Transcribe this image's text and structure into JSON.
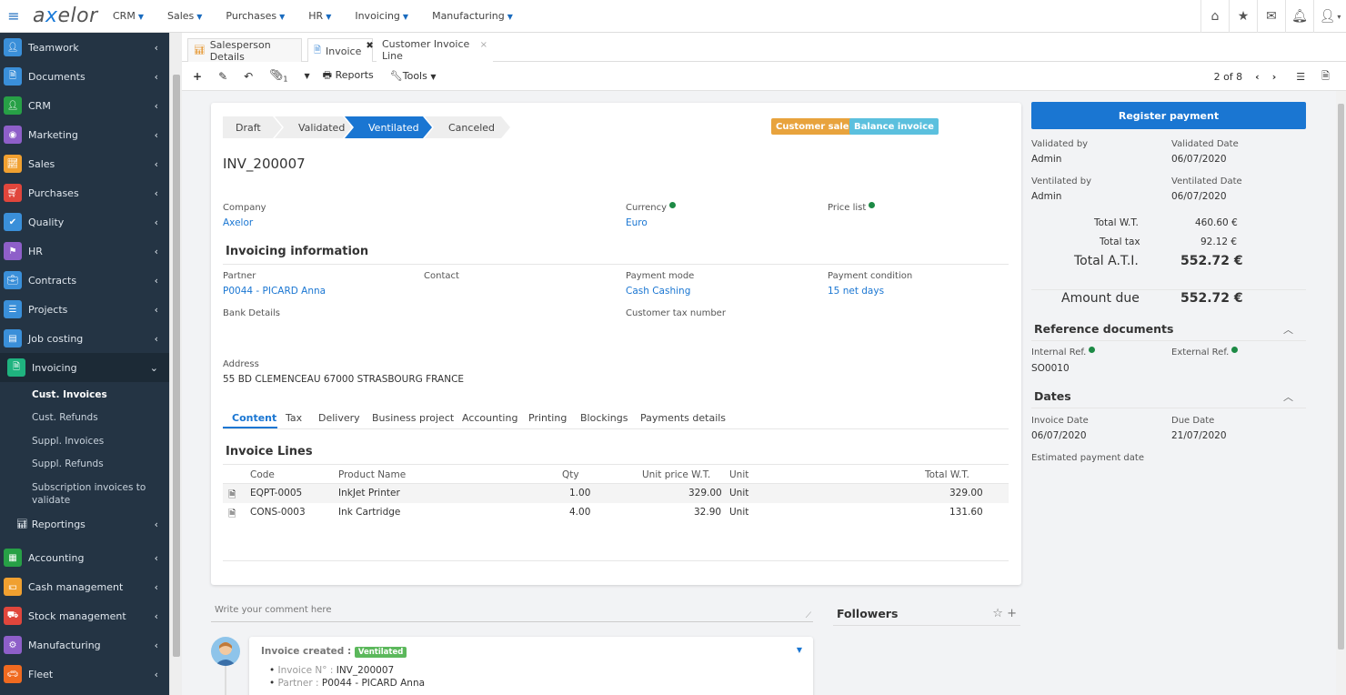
{
  "app": {
    "logo": "axelor"
  },
  "topmenu": [
    {
      "label": "CRM"
    },
    {
      "label": "Sales"
    },
    {
      "label": "Purchases"
    },
    {
      "label": "HR"
    },
    {
      "label": "Invoicing"
    },
    {
      "label": "Manufacturing"
    }
  ],
  "topicons": [
    "home-icon",
    "star-icon",
    "envelope-icon",
    "bell-icon",
    "user-icon"
  ],
  "sidebar": {
    "items": [
      {
        "label": "Teamwork",
        "color": "#3a8fd9"
      },
      {
        "label": "Documents",
        "color": "#3a8fd9"
      },
      {
        "label": "CRM",
        "color": "#27a046"
      },
      {
        "label": "Marketing",
        "color": "#8e5fc9"
      },
      {
        "label": "Sales",
        "color": "#f0a030"
      },
      {
        "label": "Purchases",
        "color": "#e0463c"
      },
      {
        "label": "Quality",
        "color": "#3a8fd9"
      },
      {
        "label": "HR",
        "color": "#8e5fc9"
      },
      {
        "label": "Contracts",
        "color": "#3a8fd9"
      },
      {
        "label": "Projects",
        "color": "#3a8fd9"
      },
      {
        "label": "Job costing",
        "color": "#3a8fd9"
      },
      {
        "label": "Invoicing",
        "color": "#1fb37f"
      }
    ],
    "subitems": [
      "Cust. Invoices",
      "Cust. Refunds",
      "Suppl. Invoices",
      "Suppl. Refunds",
      "Subscription invoices to",
      "validate"
    ],
    "reportings": "Reportings",
    "items2": [
      {
        "label": "Accounting",
        "color": "#27a046"
      },
      {
        "label": "Cash management",
        "color": "#f0a030"
      },
      {
        "label": "Stock management",
        "color": "#e0463c"
      },
      {
        "label": "Manufacturing",
        "color": "#8e5fc9"
      },
      {
        "label": "Fleet",
        "color": "#f06a20"
      }
    ]
  },
  "tabs": [
    {
      "label": "Salesperson Details"
    },
    {
      "label": "Invoice"
    },
    {
      "label": "Customer Invoice Line"
    }
  ],
  "toolbar": {
    "attach_count": "1",
    "reports": "Reports",
    "tools": "Tools",
    "pager": "2 of 8"
  },
  "statusbar": [
    "Draft",
    "Validated",
    "Ventilated",
    "Canceled"
  ],
  "badges": {
    "customer_sale": "Customer sale",
    "balance_invoice": "Balance invoice",
    "customer_sale_color": "#e8a33d",
    "balance_color": "#5bc0de"
  },
  "invoice": {
    "number": "INV_200007",
    "company_label": "Company",
    "company": "Axelor",
    "currency_label": "Currency",
    "currency": "Euro",
    "pricelist_label": "Price list",
    "section_invoicing": "Invoicing information",
    "partner_label": "Partner",
    "partner": "P0044 - PICARD Anna",
    "contact_label": "Contact",
    "paymode_label": "Payment mode",
    "paymode": "Cash Cashing",
    "paycond_label": "Payment condition",
    "paycond": "15 net days",
    "bank_label": "Bank Details",
    "taxnum_label": "Customer tax number",
    "address_label": "Address",
    "address": "55 BD CLEMENCEAU 67000 STRASBOURG FRANCE"
  },
  "content_tabs": [
    "Content",
    "Tax",
    "Delivery",
    "Business project",
    "Accounting",
    "Printing",
    "Blockings",
    "Payments details"
  ],
  "lines": {
    "title": "Invoice Lines",
    "headers": [
      "Code",
      "Product Name",
      "Qty",
      "Unit price W.T.",
      "Unit",
      "Total W.T."
    ],
    "rows": [
      {
        "code": "EQPT-0005",
        "product": "InkJet Printer",
        "qty": "1.00",
        "price": "329.00",
        "unit": "Unit",
        "total": "329.00"
      },
      {
        "code": "CONS-0003",
        "product": "Ink Cartridge",
        "qty": "4.00",
        "price": "32.90",
        "unit": "Unit",
        "total": "131.60"
      }
    ]
  },
  "right": {
    "register": "Register payment",
    "validated_by_label": "Validated by",
    "validated_by": "Admin",
    "validated_date_label": "Validated Date",
    "validated_date": "06/07/2020",
    "ventilated_by_label": "Ventilated by",
    "ventilated_by": "Admin",
    "ventilated_date_label": "Ventilated Date",
    "ventilated_date": "06/07/2020",
    "total_wt_label": "Total W.T.",
    "total_wt": "460.60 €",
    "total_tax_label": "Total tax",
    "total_tax": "92.12 €",
    "total_ati_label": "Total A.T.I.",
    "total_ati": "552.72 €",
    "amount_due_label": "Amount due",
    "amount_due": "552.72 €",
    "refdocs": "Reference documents",
    "internal_ref_label": "Internal Ref.",
    "internal_ref": "SO0010",
    "external_ref_label": "External Ref.",
    "dates": "Dates",
    "invoice_date_label": "Invoice Date",
    "invoice_date": "06/07/2020",
    "due_date_label": "Due Date",
    "due_date": "21/07/2020",
    "est_pay_label": "Estimated payment date"
  },
  "comments": {
    "placeholder": "Write your comment here",
    "followers": "Followers",
    "event": "Invoice created :",
    "event_badge": "Ventilated",
    "detail1_label": "Invoice N° :",
    "detail1": "INV_200007",
    "detail2_label": "Partner :",
    "detail2": "P0044 - PICARD Anna"
  }
}
